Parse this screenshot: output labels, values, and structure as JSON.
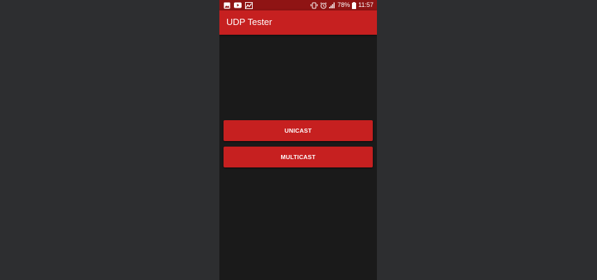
{
  "colors": {
    "background": "#2d2e30",
    "screen": "#1a1a1a",
    "status_bar": "#8f1414",
    "accent": "#c62020"
  },
  "status_bar": {
    "left_icons": [
      "image-icon",
      "youtube-icon",
      "chart-icon"
    ],
    "right_icons": [
      "vibrate-icon",
      "alarm-icon",
      "signal-icon",
      "battery-icon"
    ],
    "battery": "78%",
    "time": "11:57"
  },
  "app_bar": {
    "title": "UDP Tester"
  },
  "buttons": {
    "unicast": "UNICAST",
    "multicast": "MULTICAST"
  }
}
